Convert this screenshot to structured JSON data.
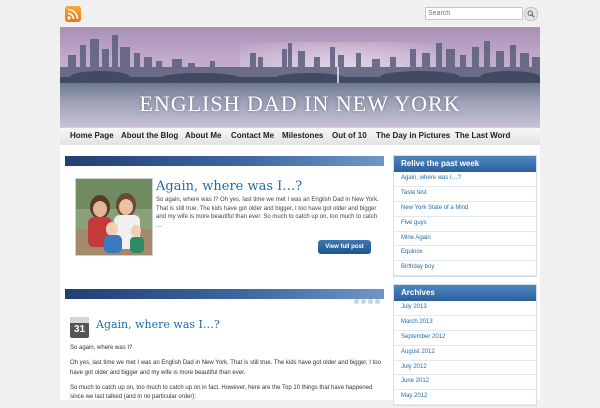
{
  "search": {
    "placeholder": "Search"
  },
  "banner": {
    "title": "ENGLISH DAD IN NEW YORK"
  },
  "nav": {
    "items": [
      {
        "label": "Home Page"
      },
      {
        "label": "About the Blog"
      },
      {
        "label": "About Me"
      },
      {
        "label": "Contact Me"
      },
      {
        "label": "Milestones"
      },
      {
        "label": "Out of 10"
      },
      {
        "label": "The Day in Pictures"
      },
      {
        "label": "The Last Word"
      }
    ]
  },
  "featured": {
    "title": "Again, where was I…?",
    "excerpt": "So again, where was I? Oh yes, last time we met I was an English Dad in New York. That is still true. The kids have got older and bigger, I too have got older and bigger and my wife is more beautiful than ever. So much to catch up on, too much to catch …",
    "button_label": "View full post",
    "slides": 5,
    "active_slide": 1
  },
  "post": {
    "date_day": "31",
    "title": "Again, where was I…?",
    "paragraphs": [
      "So again, where was I?",
      "Oh yes, last time we met I was an English Dad in New York. That is still true. The kids have got older and bigger, I too have got older and bigger and my wife is more beautiful than ever.",
      "So much to catch up on, too much to catch up on in fact. However, here are the Top 10 things that have happened since we last talked (and in no particular order):"
    ]
  },
  "sidebar": {
    "relive": {
      "title": "Relive the past week",
      "items": [
        "Again, where was I…?",
        "Taste test",
        "New York State of a Mind",
        "Five guys",
        "Mine Again",
        "Equinox",
        "Birthday boy"
      ]
    },
    "archives": {
      "title": "Archives",
      "items": [
        "July 2013",
        "March 2013",
        "September 2012",
        "August 2012",
        "July 2012",
        "June 2012",
        "May 2012"
      ]
    }
  },
  "colors": {
    "link": "#1f6da8",
    "accent_bar": "#2c5f9b",
    "rss": "#f08c2a"
  }
}
